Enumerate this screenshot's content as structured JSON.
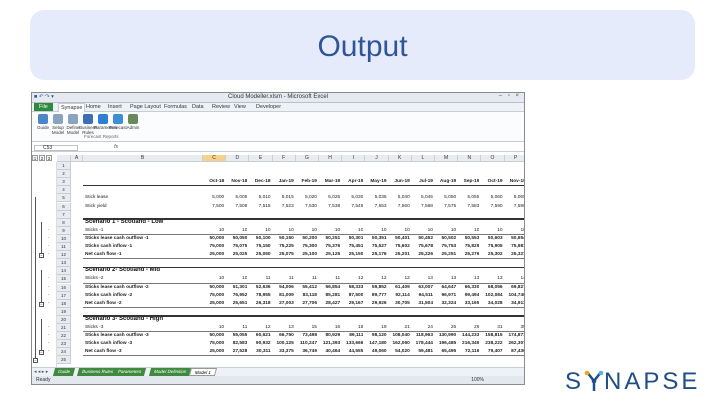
{
  "slide": {
    "title": "Output"
  },
  "window": {
    "title": "Cloud Modeller.xlsm - Microsoft Excel",
    "controls": "– ▫ ×"
  },
  "ribbon_tabs": [
    "File",
    "Synapse",
    "Home",
    "Insert",
    "Page Layout",
    "Formulas",
    "Data",
    "Review",
    "View",
    "Developer"
  ],
  "ribbon_buttons": [
    {
      "label": "Guide",
      "icon": "guide-icon",
      "color": "#4a86c8"
    },
    {
      "label": "Setup Model",
      "icon": "setup-icon",
      "color": "#8aa3c1"
    },
    {
      "label": "Define Model",
      "icon": "define-icon",
      "color": "#8aa3c1"
    },
    {
      "label": "Business Rules",
      "icon": "rules-icon",
      "color": "#3b6fb6"
    },
    {
      "label": "Parameters",
      "icon": "parameters-icon",
      "color": "#2f7fd1"
    },
    {
      "label": "Forecast",
      "icon": "forecast-icon",
      "color": "#3c8ed6"
    },
    {
      "label": "Admin",
      "icon": "admin-icon",
      "color": "#6a8a5a"
    }
  ],
  "ribbon_group": "Forecast Reports",
  "name_box": "C53",
  "fx": "fx",
  "columns": [
    "A",
    "B",
    "C",
    "D",
    "E",
    "F",
    "G",
    "H",
    "I",
    "J",
    "K",
    "L",
    "M",
    "N",
    "O",
    "P"
  ],
  "months": [
    "Oct-18",
    "Nov-18",
    "Dec-18",
    "Jan-19",
    "Feb-19",
    "Mar-19",
    "Apr-19",
    "May-19",
    "Jun-19",
    "Jul-19",
    "Aug-19",
    "Sep-19",
    "Oct-19",
    "Nov-19"
  ],
  "rows": [
    {
      "n": "1"
    },
    {
      "n": "2"
    },
    {
      "n": "3",
      "type": "months"
    },
    {
      "n": "4"
    },
    {
      "n": "5",
      "label": "Stick lease",
      "values": [
        "5,000",
        "5,005",
        "5,010",
        "5,015",
        "5,020",
        "5,025",
        "5,030",
        "5,035",
        "5,040",
        "5,045",
        "5,050",
        "5,055",
        "5,060",
        "5,065"
      ]
    },
    {
      "n": "6",
      "label": "Stick yield",
      "values": [
        "7,500",
        "7,508",
        "7,515",
        "7,523",
        "7,530",
        "7,538",
        "7,545",
        "7,553",
        "7,560",
        "7,568",
        "7,575",
        "7,583",
        "7,590",
        "7,598"
      ]
    },
    {
      "n": "7"
    },
    {
      "n": "8",
      "label": "Scenario 1 - Scotland - Low",
      "type": "heading"
    },
    {
      "n": "9",
      "label": "Sticks -1",
      "values": [
        "10",
        "10",
        "10",
        "10",
        "10",
        "10",
        "10",
        "10",
        "10",
        "10",
        "10",
        "10",
        "10",
        "10"
      ]
    },
    {
      "n": "10",
      "label": "Sticks lease cash outflow -1",
      "bold": true,
      "values": [
        "50,000",
        "50,050",
        "50,100",
        "50,150",
        "50,200",
        "50,251",
        "50,301",
        "50,351",
        "50,401",
        "50,452",
        "50,502",
        "50,553",
        "50,603",
        "50,654"
      ]
    },
    {
      "n": "11",
      "label": "Sticks cash inflow -1",
      "bold": true,
      "values": [
        "75,000",
        "75,075",
        "75,150",
        "75,225",
        "75,300",
        "75,376",
        "75,451",
        "75,527",
        "75,602",
        "75,678",
        "75,753",
        "75,829",
        "75,905",
        "75,981"
      ]
    },
    {
      "n": "12",
      "label": "Net cash flow -1",
      "bold": true,
      "values": [
        "25,000",
        "25,025",
        "25,050",
        "25,075",
        "25,100",
        "25,125",
        "25,150",
        "25,176",
        "25,201",
        "25,226",
        "25,251",
        "25,276",
        "25,302",
        "25,327"
      ]
    },
    {
      "n": "13"
    },
    {
      "n": "14",
      "label": "Scenario 2- Scotland - Mid",
      "type": "heading"
    },
    {
      "n": "15",
      "label": "Sticks -2",
      "values": [
        "10",
        "10",
        "11",
        "11",
        "11",
        "11",
        "12",
        "12",
        "12",
        "13",
        "13",
        "13",
        "13",
        "14"
      ]
    },
    {
      "n": "16",
      "label": "Sticks lease cash outflow -2",
      "bold": true,
      "values": [
        "50,000",
        "51,301",
        "52,636",
        "54,006",
        "55,412",
        "56,854",
        "58,333",
        "59,852",
        "61,409",
        "63,007",
        "64,647",
        "66,330",
        "68,056",
        "69,827"
      ]
    },
    {
      "n": "17",
      "label": "Sticks cash inflow -2",
      "bold": true,
      "values": [
        "75,000",
        "76,952",
        "78,955",
        "81,009",
        "83,118",
        "85,281",
        "87,500",
        "89,777",
        "92,114",
        "94,511",
        "96,971",
        "99,494",
        "102,084",
        "104,740"
      ]
    },
    {
      "n": "18",
      "label": "Net cash flow -2",
      "bold": true,
      "values": [
        "25,000",
        "25,651",
        "26,318",
        "27,003",
        "27,706",
        "28,427",
        "29,167",
        "29,926",
        "30,705",
        "31,504",
        "32,324",
        "33,165",
        "34,028",
        "34,913"
      ]
    },
    {
      "n": "19"
    },
    {
      "n": "20",
      "label": "Scenario 3- Scotland - High",
      "type": "heading"
    },
    {
      "n": "21",
      "label": "Sticks -3",
      "values": [
        "10",
        "11",
        "12",
        "13",
        "15",
        "16",
        "18",
        "19",
        "21",
        "24",
        "26",
        "29",
        "31",
        "35"
      ]
    },
    {
      "n": "22",
      "label": "Sticks lease cash outflow -3",
      "bold": true,
      "values": [
        "50,000",
        "55,055",
        "60,621",
        "66,750",
        "73,498",
        "80,929",
        "89,111",
        "98,120",
        "108,040",
        "118,963",
        "130,990",
        "144,233",
        "158,815",
        "174,871"
      ]
    },
    {
      "n": "23",
      "label": "Sticks cash inflow -3",
      "bold": true,
      "values": [
        "75,000",
        "82,583",
        "90,932",
        "100,125",
        "110,247",
        "121,393",
        "133,666",
        "147,180",
        "162,060",
        "178,444",
        "196,485",
        "216,349",
        "238,222",
        "262,307"
      ]
    },
    {
      "n": "24",
      "label": "Net cash flow -3",
      "bold": true,
      "values": [
        "25,000",
        "27,528",
        "30,311",
        "33,375",
        "36,749",
        "40,464",
        "44,555",
        "49,060",
        "54,020",
        "59,481",
        "65,495",
        "72,116",
        "79,407",
        "87,436"
      ]
    },
    {
      "n": "25"
    }
  ],
  "sheet_tabs": [
    {
      "label": "Guide",
      "color": "#3f8a3f"
    },
    {
      "label": "Business Rules",
      "color": "#3f8a3f"
    },
    {
      "label": "Parameters",
      "color": "#3f8a3f"
    },
    {
      "label": "Model Definition",
      "color": "#3f8a3f"
    },
    {
      "label": "Model 1",
      "color": "#ffffff",
      "active": true
    }
  ],
  "status": {
    "ready": "Ready",
    "zoom": "100%"
  },
  "logo": {
    "before": "S",
    "after": "NAPSE"
  }
}
